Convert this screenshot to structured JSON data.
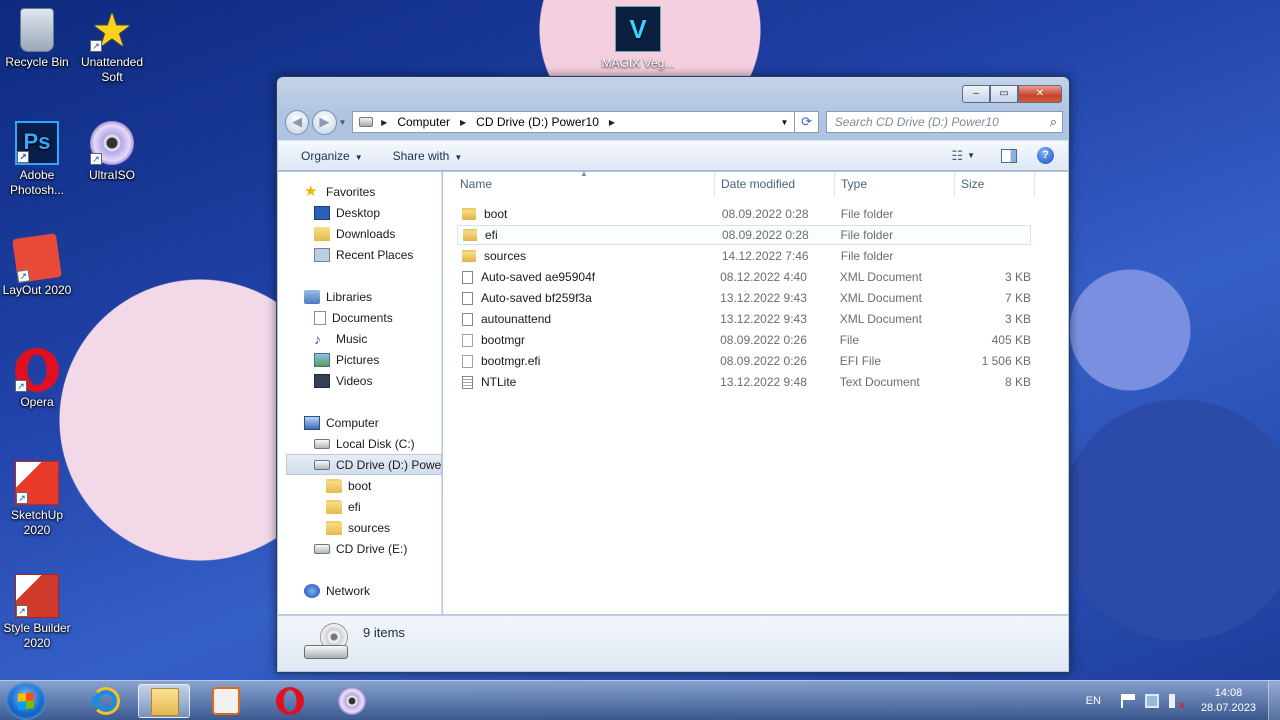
{
  "desktop": {
    "icons": [
      {
        "label": "Recycle Bin",
        "icon": "recycle-bin-icon"
      },
      {
        "label": "Unattended Soft",
        "icon": "star-icon"
      },
      {
        "label": "Adobe Photosh...",
        "icon": "photoshop-icon"
      },
      {
        "label": "UltraISO",
        "icon": "disc-icon"
      },
      {
        "label": "LayOut 2020",
        "icon": "layout-icon"
      },
      {
        "label": "Opera",
        "icon": "opera-icon"
      },
      {
        "label": "SketchUp 2020",
        "icon": "sketchup-icon"
      },
      {
        "label": "Style Builder 2020",
        "icon": "style-builder-icon"
      },
      {
        "label": "MAGIX Veg...",
        "icon": "magix-vegas-icon"
      }
    ]
  },
  "window": {
    "controls": {
      "minimize": "–",
      "maximize": "▭",
      "close": "✕"
    },
    "breadcrumb": [
      "Computer",
      "CD Drive (D:) Power10"
    ],
    "search_placeholder": "Search CD Drive (D:) Power10",
    "toolbar": {
      "organize": "Organize",
      "share_with": "Share with"
    },
    "nav": {
      "favorites": "Favorites",
      "desktop": "Desktop",
      "downloads": "Downloads",
      "recent_places": "Recent Places",
      "libraries": "Libraries",
      "documents": "Documents",
      "music": "Music",
      "pictures": "Pictures",
      "videos": "Videos",
      "computer": "Computer",
      "local_disk": "Local Disk (C:)",
      "cd_drive_d": "CD Drive (D:) Power10",
      "boot": "boot",
      "efi": "efi",
      "sources": "sources",
      "cd_drive_e": "CD Drive (E:)",
      "network": "Network"
    },
    "columns": {
      "name": "Name",
      "date": "Date modified",
      "type": "Type",
      "size": "Size"
    },
    "files": [
      {
        "name": "boot",
        "date": "08.09.2022 0:28",
        "type": "File folder",
        "size": "",
        "kind": "folder"
      },
      {
        "name": "efi",
        "date": "08.09.2022 0:28",
        "type": "File folder",
        "size": "",
        "kind": "folder"
      },
      {
        "name": "sources",
        "date": "14.12.2022 7:46",
        "type": "File folder",
        "size": "",
        "kind": "folder"
      },
      {
        "name": "Auto-saved ae95904f",
        "date": "08.12.2022 4:40",
        "type": "XML Document",
        "size": "3 KB",
        "kind": "xml"
      },
      {
        "name": "Auto-saved bf259f3a",
        "date": "13.12.2022 9:43",
        "type": "XML Document",
        "size": "7 KB",
        "kind": "xml"
      },
      {
        "name": "autounattend",
        "date": "13.12.2022 9:43",
        "type": "XML Document",
        "size": "3 KB",
        "kind": "xml"
      },
      {
        "name": "bootmgr",
        "date": "08.09.2022 0:26",
        "type": "File",
        "size": "405 KB",
        "kind": "file"
      },
      {
        "name": "bootmgr.efi",
        "date": "08.09.2022 0:26",
        "type": "EFI File",
        "size": "1 506 KB",
        "kind": "file"
      },
      {
        "name": "NTLite",
        "date": "13.12.2022 9:48",
        "type": "Text Document",
        "size": "8 KB",
        "kind": "txt"
      }
    ],
    "status": "9 items"
  },
  "taskbar": {
    "apps": [
      "internet-explorer-icon",
      "explorer-icon",
      "media-player-icon",
      "opera-icon",
      "ultraiso-icon"
    ],
    "language": "EN",
    "time": "14:08",
    "date": "28.07.2023"
  }
}
